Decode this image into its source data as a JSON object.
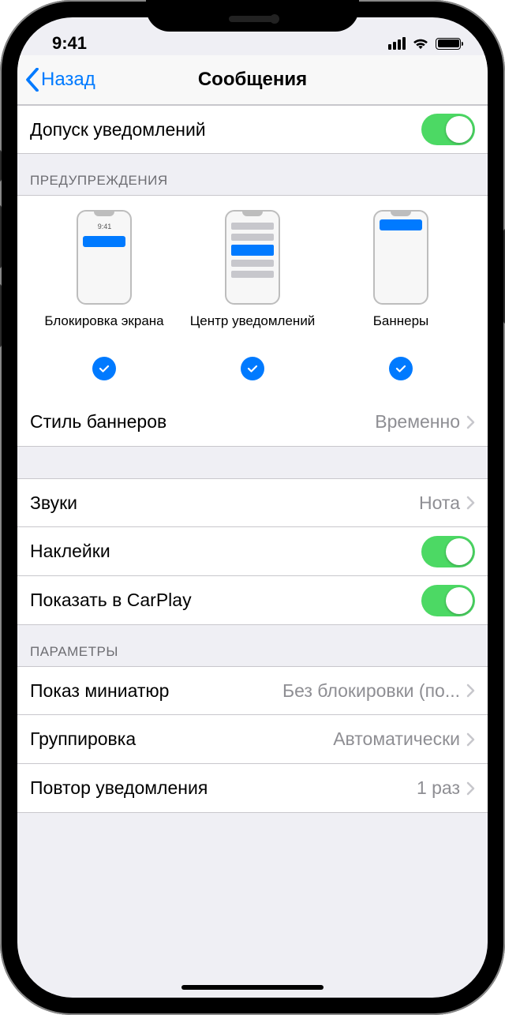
{
  "statusbar": {
    "time": "9:41"
  },
  "nav": {
    "back": "Назад",
    "title": "Сообщения"
  },
  "allow": {
    "label": "Допуск уведомлений"
  },
  "sections": {
    "alerts_header": "ПРЕДУПРЕЖДЕНИЯ",
    "options_header": "ПАРАМЕТРЫ"
  },
  "alerts": {
    "lock": {
      "label": "Блокировка экрана",
      "time": "9:41"
    },
    "center": {
      "label": "Центр уведомлений"
    },
    "banner": {
      "label": "Баннеры"
    }
  },
  "banner_style": {
    "label": "Стиль баннеров",
    "value": "Временно"
  },
  "sounds": {
    "label": "Звуки",
    "value": "Нота"
  },
  "badges": {
    "label": "Наклейки"
  },
  "carplay": {
    "label": "Показать в CarPlay"
  },
  "previews": {
    "label": "Показ миниатюр",
    "value": "Без блокировки (по..."
  },
  "grouping": {
    "label": "Группировка",
    "value": "Автоматически"
  },
  "repeat": {
    "label": "Повтор уведомления",
    "value": "1 раз"
  }
}
